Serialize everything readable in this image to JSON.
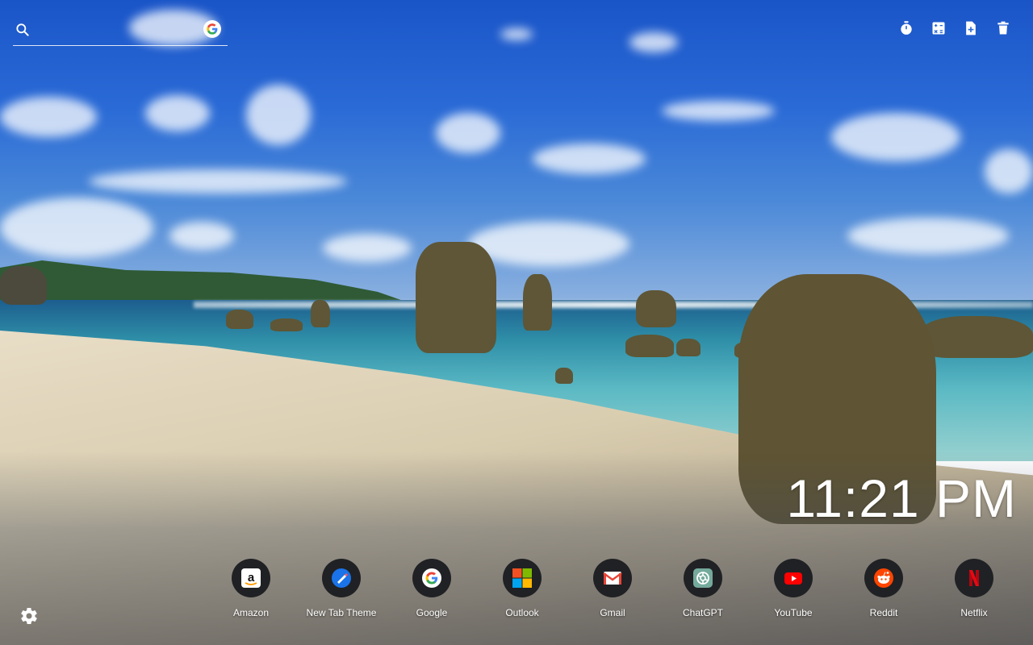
{
  "search": {
    "placeholder": "",
    "value": ""
  },
  "toolbar": {
    "buttons": [
      {
        "icon": "timer-icon"
      },
      {
        "icon": "calculator-icon"
      },
      {
        "icon": "add-note-icon"
      },
      {
        "icon": "trash-icon"
      }
    ]
  },
  "clock": {
    "time": "11:21 PM"
  },
  "shortcuts": [
    {
      "label": "Amazon",
      "icon": "amazon-icon"
    },
    {
      "label": "New Tab Theme",
      "icon": "new-tab-theme-icon"
    },
    {
      "label": "Google",
      "icon": "google-icon"
    },
    {
      "label": "Outlook",
      "icon": "outlook-icon"
    },
    {
      "label": "Gmail",
      "icon": "gmail-icon"
    },
    {
      "label": "ChatGPT",
      "icon": "chatgpt-icon"
    },
    {
      "label": "YouTube",
      "icon": "youtube-icon"
    },
    {
      "label": "Reddit",
      "icon": "reddit-icon"
    },
    {
      "label": "Netflix",
      "icon": "netflix-icon"
    }
  ],
  "settings": {
    "icon": "gear-icon"
  },
  "colors": {
    "icon_circle": "#202124",
    "text": "#ffffff",
    "youtube_red": "#ff0000",
    "reddit_orange": "#ff4500",
    "netflix_red": "#e50914"
  }
}
